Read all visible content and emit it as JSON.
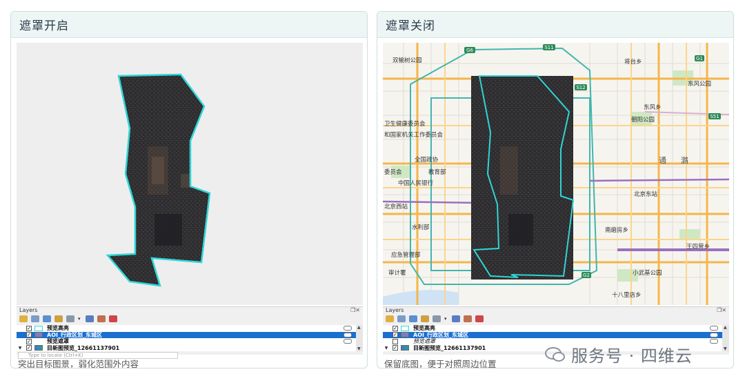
{
  "panels": [
    {
      "title": "遮罩开启",
      "caption": "突出目标图景，弱化范围外内容",
      "mask_enabled": true
    },
    {
      "title": "遮罩关闭",
      "caption": "保留底图，便于对照周边位置",
      "mask_enabled": false
    }
  ],
  "layers_panel": {
    "title": "Layers",
    "locate_placeholder": "Type to locate (Ctrl+K)",
    "rows": [
      {
        "label": "预览高亮",
        "checked": true,
        "selected": false
      },
      {
        "label": "AOI_行政区划_东城区",
        "checked": true,
        "selected": true
      },
      {
        "label": "预览遮罩",
        "checked": true,
        "selected": false
      },
      {
        "label": "目新图预览_12661137901",
        "checked": true,
        "selected": false
      }
    ],
    "right_rows": [
      {
        "label": "预览高亮",
        "checked": true,
        "selected": false
      },
      {
        "label": "AOI_行政区划_东城区",
        "checked": true,
        "selected": true
      },
      {
        "label": "预览遮罩",
        "checked": false,
        "selected": false
      },
      {
        "label": "目新图预览_12661137901",
        "checked": true,
        "selected": false
      }
    ]
  },
  "map_labels": [
    "双榆树公园",
    "卫生健康委员会",
    "和国家机关工作委员会",
    "全国政协",
    "委员会",
    "教育部",
    "中国人民银行",
    "北京西站",
    "水利部",
    "应急管理部",
    "审计署",
    "将台乡",
    "东风公园",
    "东风乡",
    "朝阳公园",
    "北京东站",
    "南磨房乡",
    "王四营乡",
    "小武基公园",
    "十八里店乡",
    "通",
    "潞"
  ],
  "road_shields": [
    "G6",
    "S11",
    "S12",
    "G1",
    "S51",
    "G2"
  ],
  "colors": {
    "accent": "#2fd6d6",
    "satellite_dark": "#2e2d30",
    "selected_row": "#1a6fd0",
    "expressway": "#f4b64a",
    "ring_road": "#3fb6ae",
    "railway": "#9a6fbf"
  },
  "watermark": "服务号 · 四维云"
}
